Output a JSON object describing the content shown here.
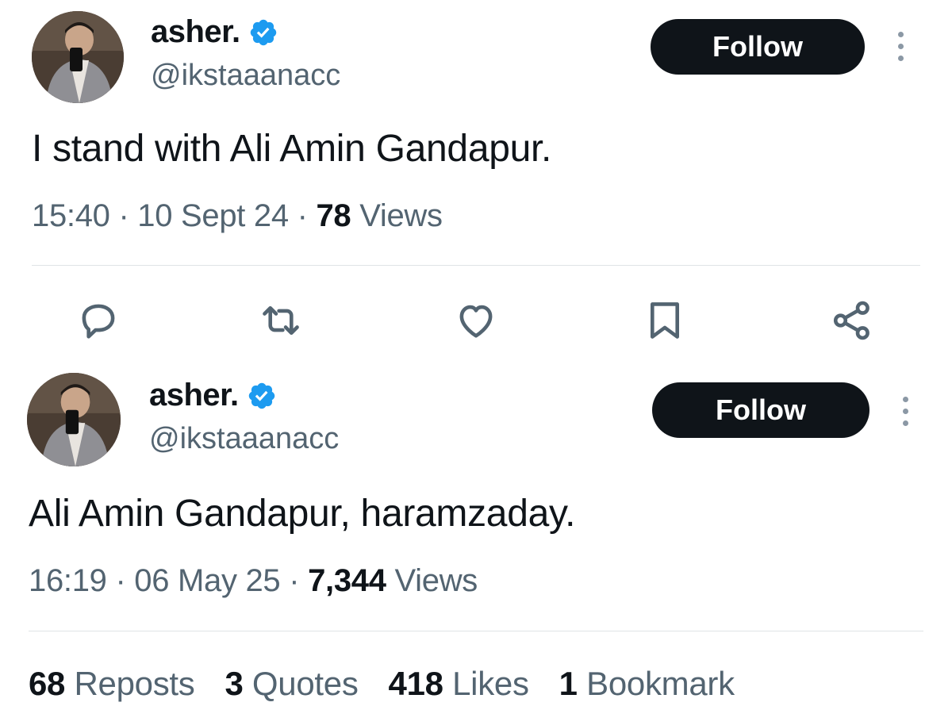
{
  "tweets": [
    {
      "display_name": "asher.",
      "handle": "@ikstaaanacc",
      "follow_label": "Follow",
      "text": "I stand with Ali Amin Gandapur.",
      "time": "15:40",
      "date": "10 Sept 24",
      "views_count": "78",
      "views_label": "Views"
    },
    {
      "display_name": "asher.",
      "handle": "@ikstaaanacc",
      "follow_label": "Follow",
      "text": "Ali Amin Gandapur, haramzaday.",
      "time": "16:19",
      "date": "06 May 25",
      "views_count": "7,344",
      "views_label": "Views"
    }
  ],
  "separator": "·",
  "actions": [
    "reply-icon",
    "retweet-icon",
    "like-icon",
    "bookmark-icon",
    "share-icon"
  ],
  "stats": [
    {
      "count": "68",
      "label": "Reposts"
    },
    {
      "count": "3",
      "label": "Quotes"
    },
    {
      "count": "418",
      "label": "Likes"
    },
    {
      "count": "1",
      "label": "Bookmark"
    }
  ],
  "colors": {
    "text": "#0f1419",
    "muted": "#536471",
    "verified": "#1d9bf0",
    "button": "#0f1419",
    "divider": "#dfe3e6"
  }
}
